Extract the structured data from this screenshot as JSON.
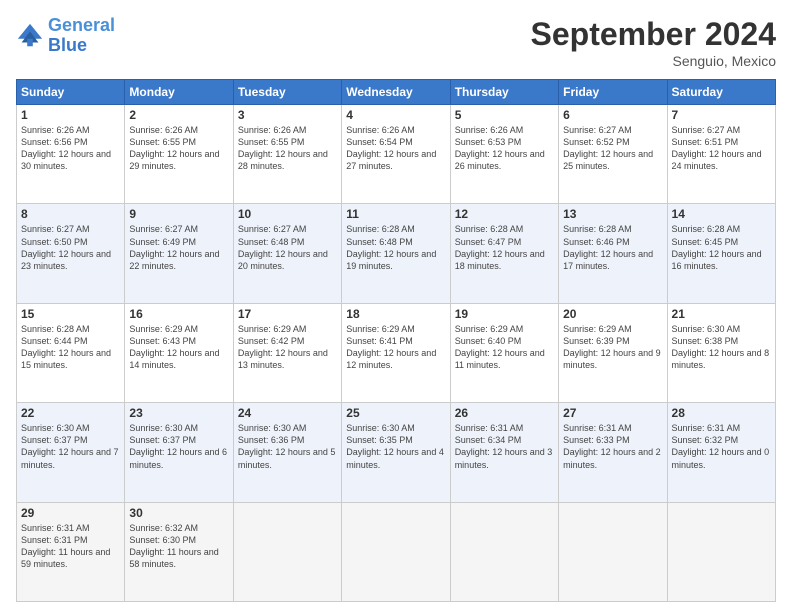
{
  "header": {
    "logo_line1": "General",
    "logo_line2": "Blue",
    "month": "September 2024",
    "location": "Senguio, Mexico"
  },
  "weekdays": [
    "Sunday",
    "Monday",
    "Tuesday",
    "Wednesday",
    "Thursday",
    "Friday",
    "Saturday"
  ],
  "weeks": [
    [
      {
        "day": "1",
        "sunrise": "Sunrise: 6:26 AM",
        "sunset": "Sunset: 6:56 PM",
        "daylight": "Daylight: 12 hours and 30 minutes."
      },
      {
        "day": "2",
        "sunrise": "Sunrise: 6:26 AM",
        "sunset": "Sunset: 6:55 PM",
        "daylight": "Daylight: 12 hours and 29 minutes."
      },
      {
        "day": "3",
        "sunrise": "Sunrise: 6:26 AM",
        "sunset": "Sunset: 6:55 PM",
        "daylight": "Daylight: 12 hours and 28 minutes."
      },
      {
        "day": "4",
        "sunrise": "Sunrise: 6:26 AM",
        "sunset": "Sunset: 6:54 PM",
        "daylight": "Daylight: 12 hours and 27 minutes."
      },
      {
        "day": "5",
        "sunrise": "Sunrise: 6:26 AM",
        "sunset": "Sunset: 6:53 PM",
        "daylight": "Daylight: 12 hours and 26 minutes."
      },
      {
        "day": "6",
        "sunrise": "Sunrise: 6:27 AM",
        "sunset": "Sunset: 6:52 PM",
        "daylight": "Daylight: 12 hours and 25 minutes."
      },
      {
        "day": "7",
        "sunrise": "Sunrise: 6:27 AM",
        "sunset": "Sunset: 6:51 PM",
        "daylight": "Daylight: 12 hours and 24 minutes."
      }
    ],
    [
      {
        "day": "8",
        "sunrise": "Sunrise: 6:27 AM",
        "sunset": "Sunset: 6:50 PM",
        "daylight": "Daylight: 12 hours and 23 minutes."
      },
      {
        "day": "9",
        "sunrise": "Sunrise: 6:27 AM",
        "sunset": "Sunset: 6:49 PM",
        "daylight": "Daylight: 12 hours and 22 minutes."
      },
      {
        "day": "10",
        "sunrise": "Sunrise: 6:27 AM",
        "sunset": "Sunset: 6:48 PM",
        "daylight": "Daylight: 12 hours and 20 minutes."
      },
      {
        "day": "11",
        "sunrise": "Sunrise: 6:28 AM",
        "sunset": "Sunset: 6:48 PM",
        "daylight": "Daylight: 12 hours and 19 minutes."
      },
      {
        "day": "12",
        "sunrise": "Sunrise: 6:28 AM",
        "sunset": "Sunset: 6:47 PM",
        "daylight": "Daylight: 12 hours and 18 minutes."
      },
      {
        "day": "13",
        "sunrise": "Sunrise: 6:28 AM",
        "sunset": "Sunset: 6:46 PM",
        "daylight": "Daylight: 12 hours and 17 minutes."
      },
      {
        "day": "14",
        "sunrise": "Sunrise: 6:28 AM",
        "sunset": "Sunset: 6:45 PM",
        "daylight": "Daylight: 12 hours and 16 minutes."
      }
    ],
    [
      {
        "day": "15",
        "sunrise": "Sunrise: 6:28 AM",
        "sunset": "Sunset: 6:44 PM",
        "daylight": "Daylight: 12 hours and 15 minutes."
      },
      {
        "day": "16",
        "sunrise": "Sunrise: 6:29 AM",
        "sunset": "Sunset: 6:43 PM",
        "daylight": "Daylight: 12 hours and 14 minutes."
      },
      {
        "day": "17",
        "sunrise": "Sunrise: 6:29 AM",
        "sunset": "Sunset: 6:42 PM",
        "daylight": "Daylight: 12 hours and 13 minutes."
      },
      {
        "day": "18",
        "sunrise": "Sunrise: 6:29 AM",
        "sunset": "Sunset: 6:41 PM",
        "daylight": "Daylight: 12 hours and 12 minutes."
      },
      {
        "day": "19",
        "sunrise": "Sunrise: 6:29 AM",
        "sunset": "Sunset: 6:40 PM",
        "daylight": "Daylight: 12 hours and 11 minutes."
      },
      {
        "day": "20",
        "sunrise": "Sunrise: 6:29 AM",
        "sunset": "Sunset: 6:39 PM",
        "daylight": "Daylight: 12 hours and 9 minutes."
      },
      {
        "day": "21",
        "sunrise": "Sunrise: 6:30 AM",
        "sunset": "Sunset: 6:38 PM",
        "daylight": "Daylight: 12 hours and 8 minutes."
      }
    ],
    [
      {
        "day": "22",
        "sunrise": "Sunrise: 6:30 AM",
        "sunset": "Sunset: 6:37 PM",
        "daylight": "Daylight: 12 hours and 7 minutes."
      },
      {
        "day": "23",
        "sunrise": "Sunrise: 6:30 AM",
        "sunset": "Sunset: 6:37 PM",
        "daylight": "Daylight: 12 hours and 6 minutes."
      },
      {
        "day": "24",
        "sunrise": "Sunrise: 6:30 AM",
        "sunset": "Sunset: 6:36 PM",
        "daylight": "Daylight: 12 hours and 5 minutes."
      },
      {
        "day": "25",
        "sunrise": "Sunrise: 6:30 AM",
        "sunset": "Sunset: 6:35 PM",
        "daylight": "Daylight: 12 hours and 4 minutes."
      },
      {
        "day": "26",
        "sunrise": "Sunrise: 6:31 AM",
        "sunset": "Sunset: 6:34 PM",
        "daylight": "Daylight: 12 hours and 3 minutes."
      },
      {
        "day": "27",
        "sunrise": "Sunrise: 6:31 AM",
        "sunset": "Sunset: 6:33 PM",
        "daylight": "Daylight: 12 hours and 2 minutes."
      },
      {
        "day": "28",
        "sunrise": "Sunrise: 6:31 AM",
        "sunset": "Sunset: 6:32 PM",
        "daylight": "Daylight: 12 hours and 0 minutes."
      }
    ],
    [
      {
        "day": "29",
        "sunrise": "Sunrise: 6:31 AM",
        "sunset": "Sunset: 6:31 PM",
        "daylight": "Daylight: 11 hours and 59 minutes."
      },
      {
        "day": "30",
        "sunrise": "Sunrise: 6:32 AM",
        "sunset": "Sunset: 6:30 PM",
        "daylight": "Daylight: 11 hours and 58 minutes."
      },
      {
        "day": "",
        "sunrise": "",
        "sunset": "",
        "daylight": ""
      },
      {
        "day": "",
        "sunrise": "",
        "sunset": "",
        "daylight": ""
      },
      {
        "day": "",
        "sunrise": "",
        "sunset": "",
        "daylight": ""
      },
      {
        "day": "",
        "sunrise": "",
        "sunset": "",
        "daylight": ""
      },
      {
        "day": "",
        "sunrise": "",
        "sunset": "",
        "daylight": ""
      }
    ]
  ]
}
